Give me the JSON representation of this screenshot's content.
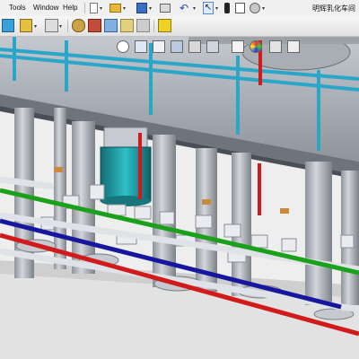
{
  "menubar": {
    "items": [
      {
        "label": "Tools"
      },
      {
        "label": "Window"
      },
      {
        "label": "Help"
      }
    ],
    "document_title": "明辉乳化车间"
  },
  "toolbar": {
    "icons": [
      "new-document-icon",
      "open-icon",
      "save-icon",
      "print-icon",
      "undo-icon",
      "select-icon",
      "traffic-light-icon",
      "file-properties-icon",
      "options-icon"
    ]
  },
  "command_manager": {
    "icons": [
      "component-icon",
      "assembly-icon",
      "mate-icon",
      "smart-fastener-icon",
      "move-component-icon",
      "exploded-view-icon",
      "explode-line-icon",
      "bill-of-materials-icon",
      "interference-icon",
      "hide-show-icon"
    ]
  },
  "heads_up_view": {
    "icons": [
      "zoom-to-fit-icon",
      "zoom-area-icon",
      "previous-view-icon",
      "section-view-icon",
      "view-orientation-icon",
      "display-style-icon",
      "hide-show-items-icon",
      "edit-appearance-icon",
      "apply-scene-icon",
      "view-settings-icon"
    ]
  },
  "colors": {
    "pipe_green": "#1aa01a",
    "pipe_blue": "#16169e",
    "pipe_red": "#d11a1a",
    "pipe_cyan": "#2aa6c8",
    "motor_teal": "#1f9aa0",
    "steel_gray": "#b4b8bf",
    "vessel_gray": "#a7abb3"
  }
}
